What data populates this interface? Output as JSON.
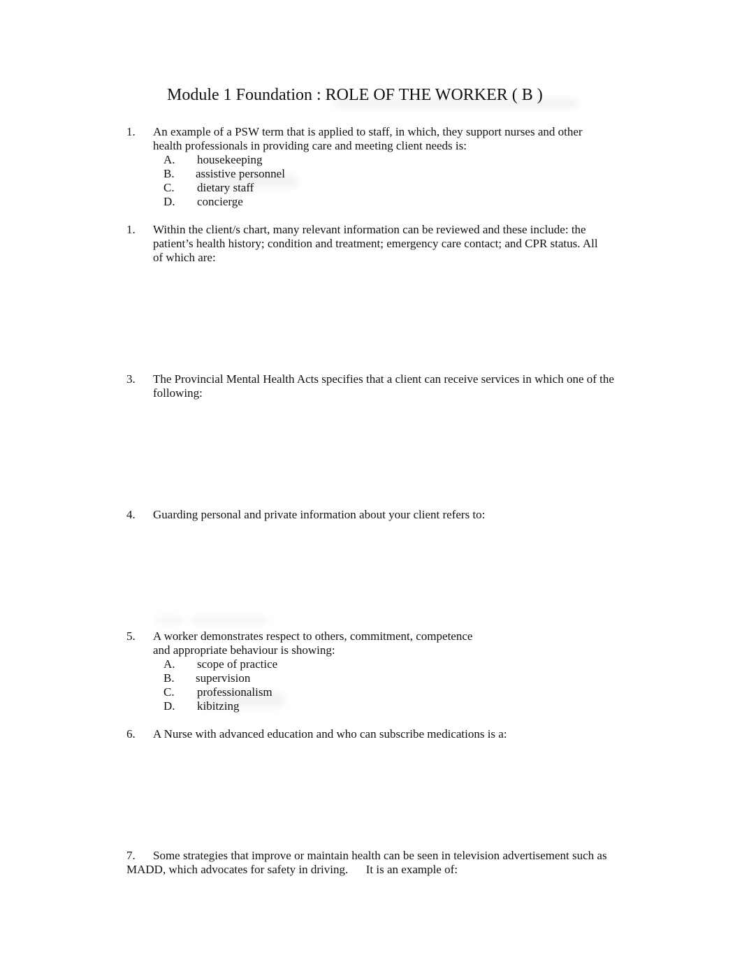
{
  "document": {
    "title": "Module 1 Foundation : ROLE OF THE WORKER ( B )",
    "questions": [
      {
        "number": "1.",
        "text": "An example of a PSW term that is applied to staff, in which, they support nurses and other health professionals in providing care and meeting client needs is:",
        "options": [
          {
            "letter": "A.",
            "text": "housekeeping"
          },
          {
            "letter": "B.",
            "text": "assistive personnel"
          },
          {
            "letter": "C.",
            "text": "dietary staff"
          },
          {
            "letter": "D.",
            "text": "concierge"
          }
        ]
      },
      {
        "number": "1.",
        "text": "Within the client/s chart, many relevant information can be reviewed and these include: the patient’s health history; condition and treatment; emergency care contact; and CPR status. All of which are:"
      },
      {
        "number": "3.",
        "text": "The Provincial Mental Health Acts specifies that a client can receive services in which one of the following:"
      },
      {
        "number": "4.",
        "text": "Guarding personal and private information about your client refers to:"
      },
      {
        "number": "5.",
        "text": "A worker demonstrates respect to others, commitment, competence and appropriate behaviour is showing:",
        "options": [
          {
            "letter": "A.",
            "text": "scope of practice"
          },
          {
            "letter": "B.",
            "text": "supervision"
          },
          {
            "letter": "C.",
            "text": "professionalism"
          },
          {
            "letter": "D.",
            "text": "kibitzing"
          }
        ]
      },
      {
        "number": "6.",
        "text": "A Nurse with advanced education and who can subscribe medications is a:"
      },
      {
        "number": "7.",
        "text": "Some strategies that improve or maintain health can be seen in television advertisement such as MADD, which advocates for safety in driving.      It is an example of:"
      }
    ]
  }
}
